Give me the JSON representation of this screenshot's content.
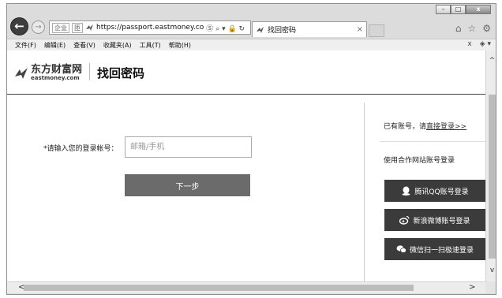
{
  "window": {
    "minimize_label": "–",
    "maximize_label": "□",
    "close_label": "x"
  },
  "nav": {
    "back_icon": "←",
    "forward_icon": "→",
    "address_badge_1": "企业",
    "address_badge_2": "匝",
    "address_url": "https://passport.eastmoney.co",
    "address_actions": "Ⓢ ⌕ ▾ 🔒 ↻",
    "tab_title": "找回密码",
    "tab_close": "×",
    "home_icon": "⌂",
    "favorites_icon": "☆",
    "tools_icon": "⚙"
  },
  "menubar": {
    "items": [
      {
        "label": "文件(F)"
      },
      {
        "label": "编辑(E)"
      },
      {
        "label": "查看(V)"
      },
      {
        "label": "收藏夹(A)"
      },
      {
        "label": "工具(T)"
      },
      {
        "label": "帮助(H)"
      }
    ],
    "close_label": "x",
    "translate_label": "◈ ▾"
  },
  "header": {
    "logo_cn": "东方财富网",
    "logo_en": "eastmoney.com",
    "title": "找回密码"
  },
  "form": {
    "label": "*请输入您的登录帐号：",
    "placeholder": "邮箱/手机",
    "next_label": "下一步"
  },
  "sidebar": {
    "have_account": "已有账号，请",
    "login_link": "直接登录>>",
    "other_login": "使用合作网站账号登录",
    "buttons": [
      {
        "label": "腾讯QQ账号登录",
        "icon": "qq-icon"
      },
      {
        "label": "新浪微博账号登录",
        "icon": "weibo-icon"
      },
      {
        "label": "微信扫一扫极速登录",
        "icon": "wechat-icon"
      }
    ]
  },
  "scrollbars": {
    "up": "^",
    "down": "v",
    "left": "<",
    "right": ">"
  },
  "colors": {
    "button": "#6b6b6b",
    "social_button": "#3b3b3b",
    "header_rule": "#444444"
  }
}
